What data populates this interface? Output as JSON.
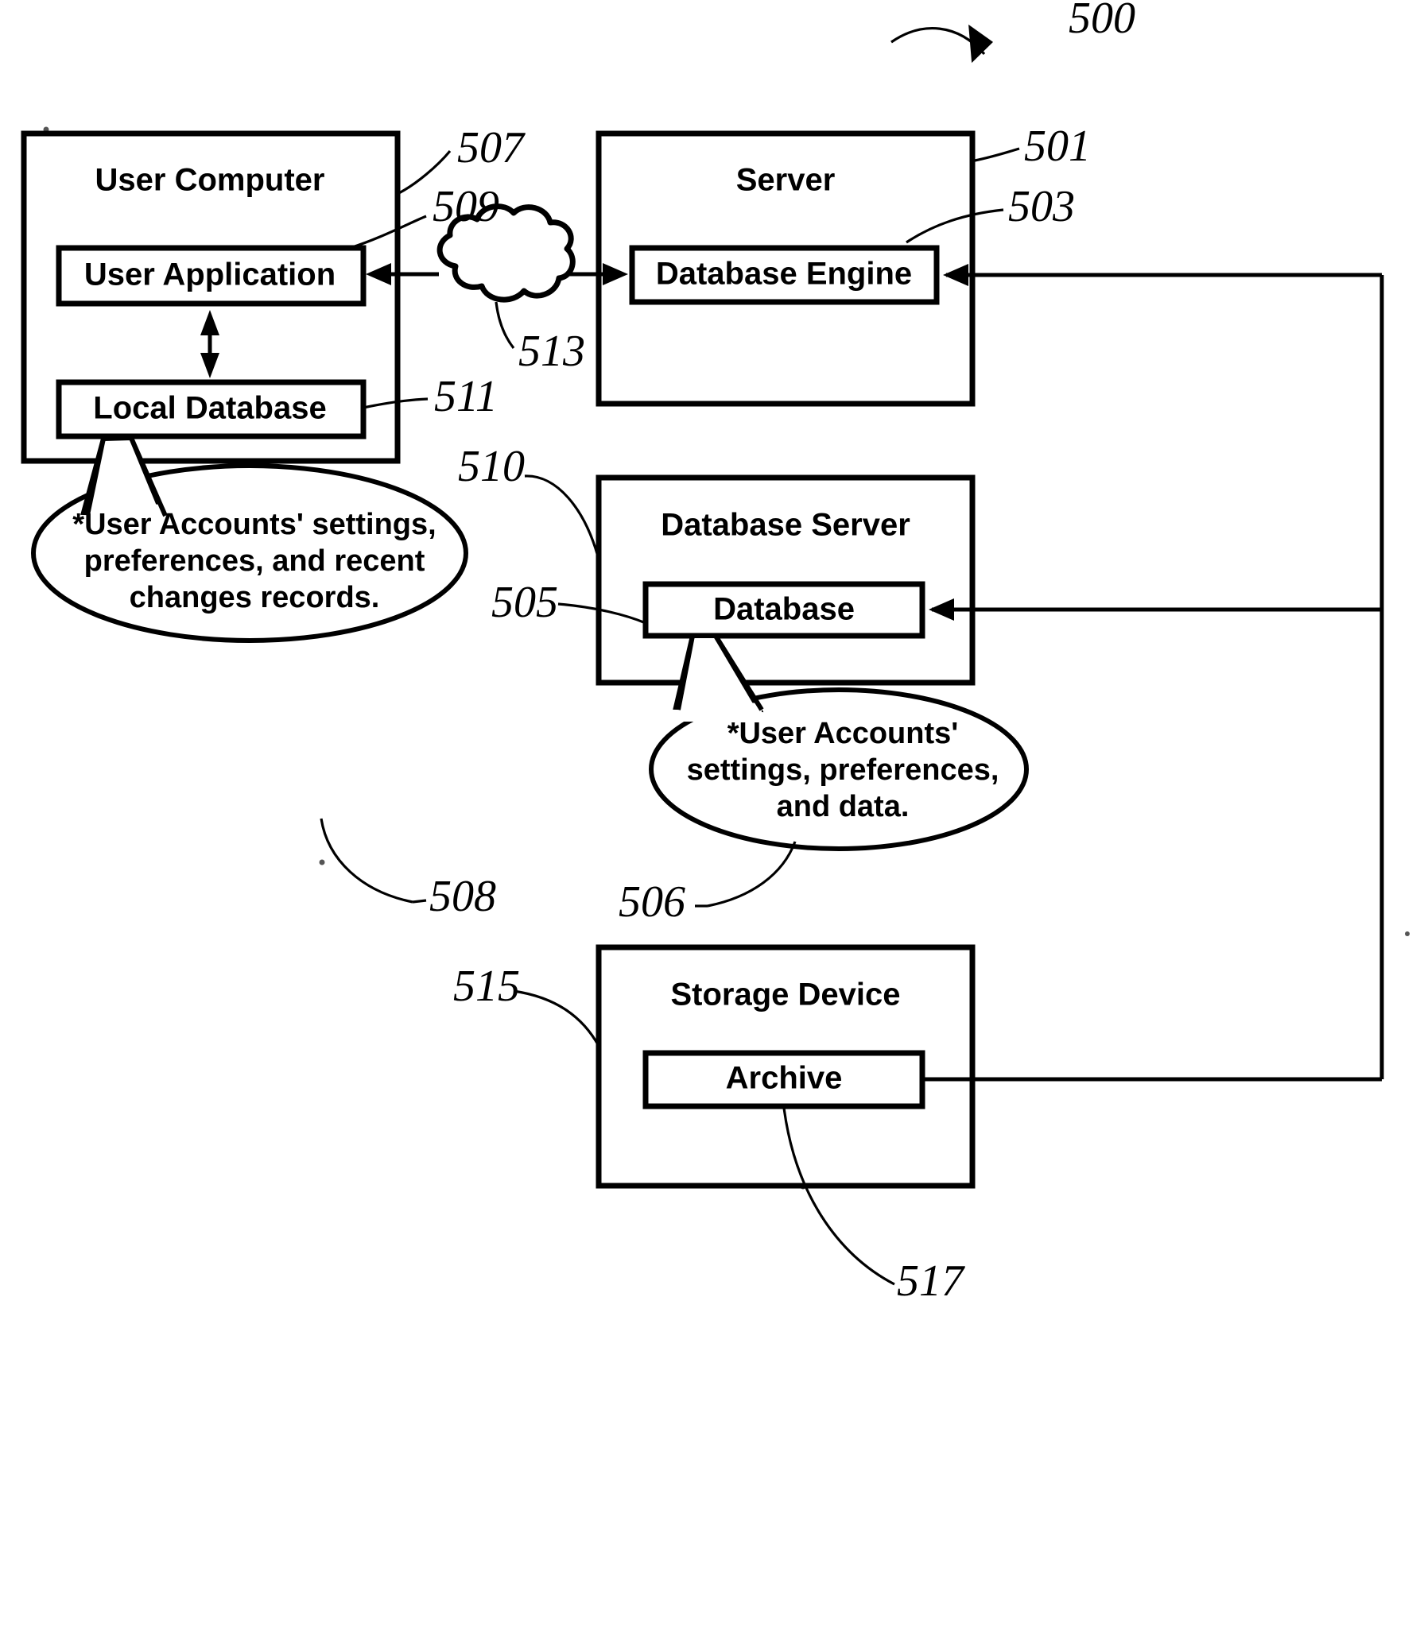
{
  "figure": {
    "id_label": "500",
    "background_color": "#ffffff",
    "line_color": "#000000"
  },
  "boxes": {
    "user_computer": {
      "label": "User Computer",
      "ref": "507"
    },
    "user_application": {
      "label": "User Application",
      "ref": "509"
    },
    "local_database": {
      "label": "Local Database",
      "ref": "511"
    },
    "server": {
      "label": "Server",
      "ref": "501"
    },
    "database_engine": {
      "label": "Database Engine",
      "ref": "503"
    },
    "database_server": {
      "label": "Database Server",
      "ref": "510"
    },
    "database": {
      "label": "Database",
      "ref": "505"
    },
    "storage_device": {
      "label": "Storage Device",
      "ref": "515"
    },
    "archive": {
      "label": "Archive",
      "ref": "517"
    }
  },
  "network": {
    "label": "cloud-network",
    "ref": "513"
  },
  "callouts": {
    "local": {
      "ref": "508",
      "lines": [
        "*User Accounts' settings,",
        "preferences, and recent",
        "changes records."
      ]
    },
    "remote": {
      "ref": "506",
      "lines": [
        "*User Accounts'",
        "settings, preferences,",
        "and data."
      ]
    }
  }
}
